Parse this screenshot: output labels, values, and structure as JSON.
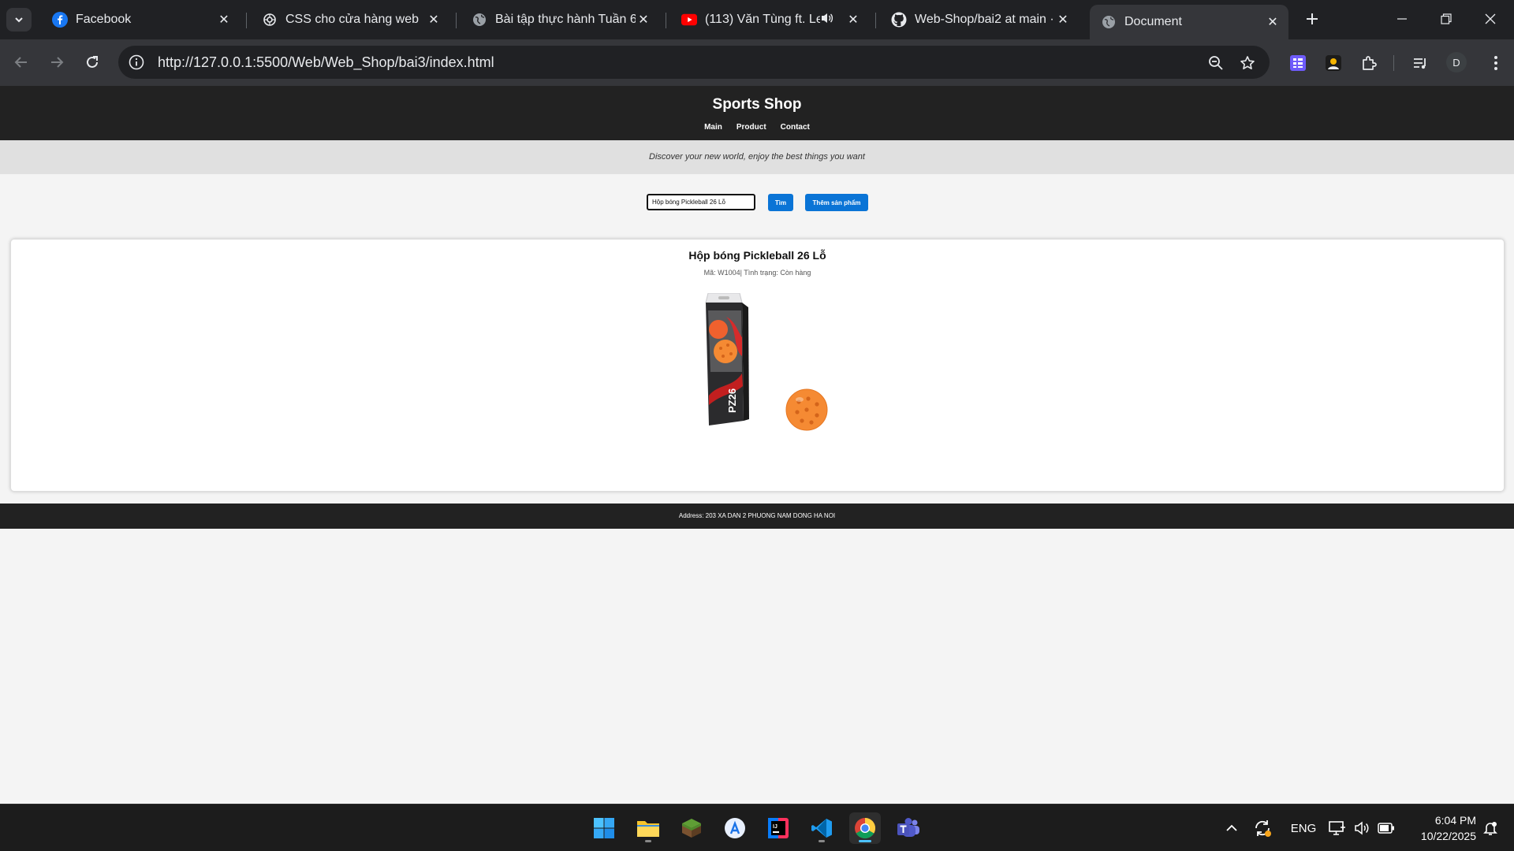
{
  "browser": {
    "tabs": [
      {
        "title": "Facebook",
        "icon": "facebook-icon"
      },
      {
        "title": "CSS cho cửa hàng web",
        "icon": "openai-icon"
      },
      {
        "title": "Bài tập thực hành Tuần 6 -",
        "icon": "globe-icon"
      },
      {
        "title": "(113) Văn Tùng ft. Levi",
        "icon": "youtube-icon"
      },
      {
        "title": "Web-Shop/bai2 at main · d",
        "icon": "github-icon"
      },
      {
        "title": "Document",
        "icon": "globe-icon"
      }
    ],
    "url": "http://127.0.0.1:5500/Web/Web_Shop/bai3/index.html",
    "profile_initial": "D"
  },
  "site": {
    "title": "Sports Shop",
    "nav": [
      "Main",
      "Product",
      "Contact"
    ],
    "tagline": "Discover your new world, enjoy the best things you want",
    "search_value": "Hộp bóng Pickleball 26 Lỗ",
    "search_button": "Tìm",
    "add_button": "Thêm sản phẩm",
    "product": {
      "name": "Hộp bóng Pickleball 26 Lỗ",
      "meta": "Mã: W1004| Tình trạng: Còn hàng",
      "box_label": "PZ26"
    },
    "footer": "Address: 203 XA DAN 2 PHUONG NAM DONG HA NOI"
  },
  "taskbar": {
    "language": "ENG",
    "time": "6:04 PM",
    "date": "10/22/2025"
  },
  "colors": {
    "header_bg": "#222222",
    "button_blue": "#0a74d6",
    "tagline_bg": "#e0e0e0",
    "ball_orange": "#f58a33"
  }
}
